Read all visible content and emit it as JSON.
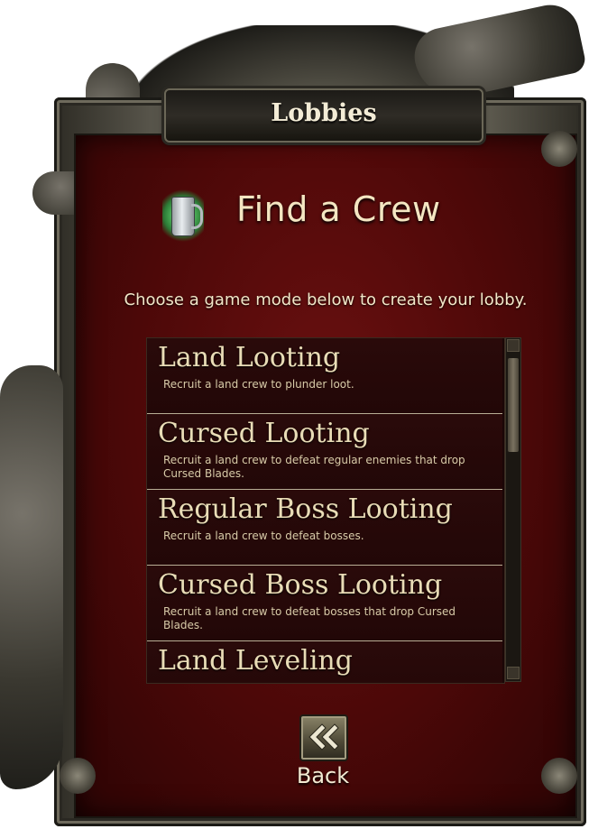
{
  "window": {
    "title": "Lobbies"
  },
  "header": {
    "icon": "tankard-icon",
    "heading": "Find a Crew"
  },
  "instruction": "Choose a game mode below to create your lobby.",
  "modes": [
    {
      "title": "Land Looting",
      "description": "Recruit a land crew to plunder loot."
    },
    {
      "title": "Cursed Looting",
      "description": "Recruit a land crew to defeat regular enemies that drop Cursed Blades."
    },
    {
      "title": "Regular Boss Looting",
      "description": "Recruit a land crew to defeat bosses."
    },
    {
      "title": "Cursed Boss Looting",
      "description": "Recruit a land crew to defeat bosses that drop Cursed Blades."
    },
    {
      "title": "Land Leveling",
      "description": ""
    }
  ],
  "back": {
    "icon": "double-chevron-left-icon",
    "label": "Back"
  },
  "colors": {
    "panel": "#4c0808",
    "text": "#f4e6c2",
    "frame": "#57544a"
  }
}
